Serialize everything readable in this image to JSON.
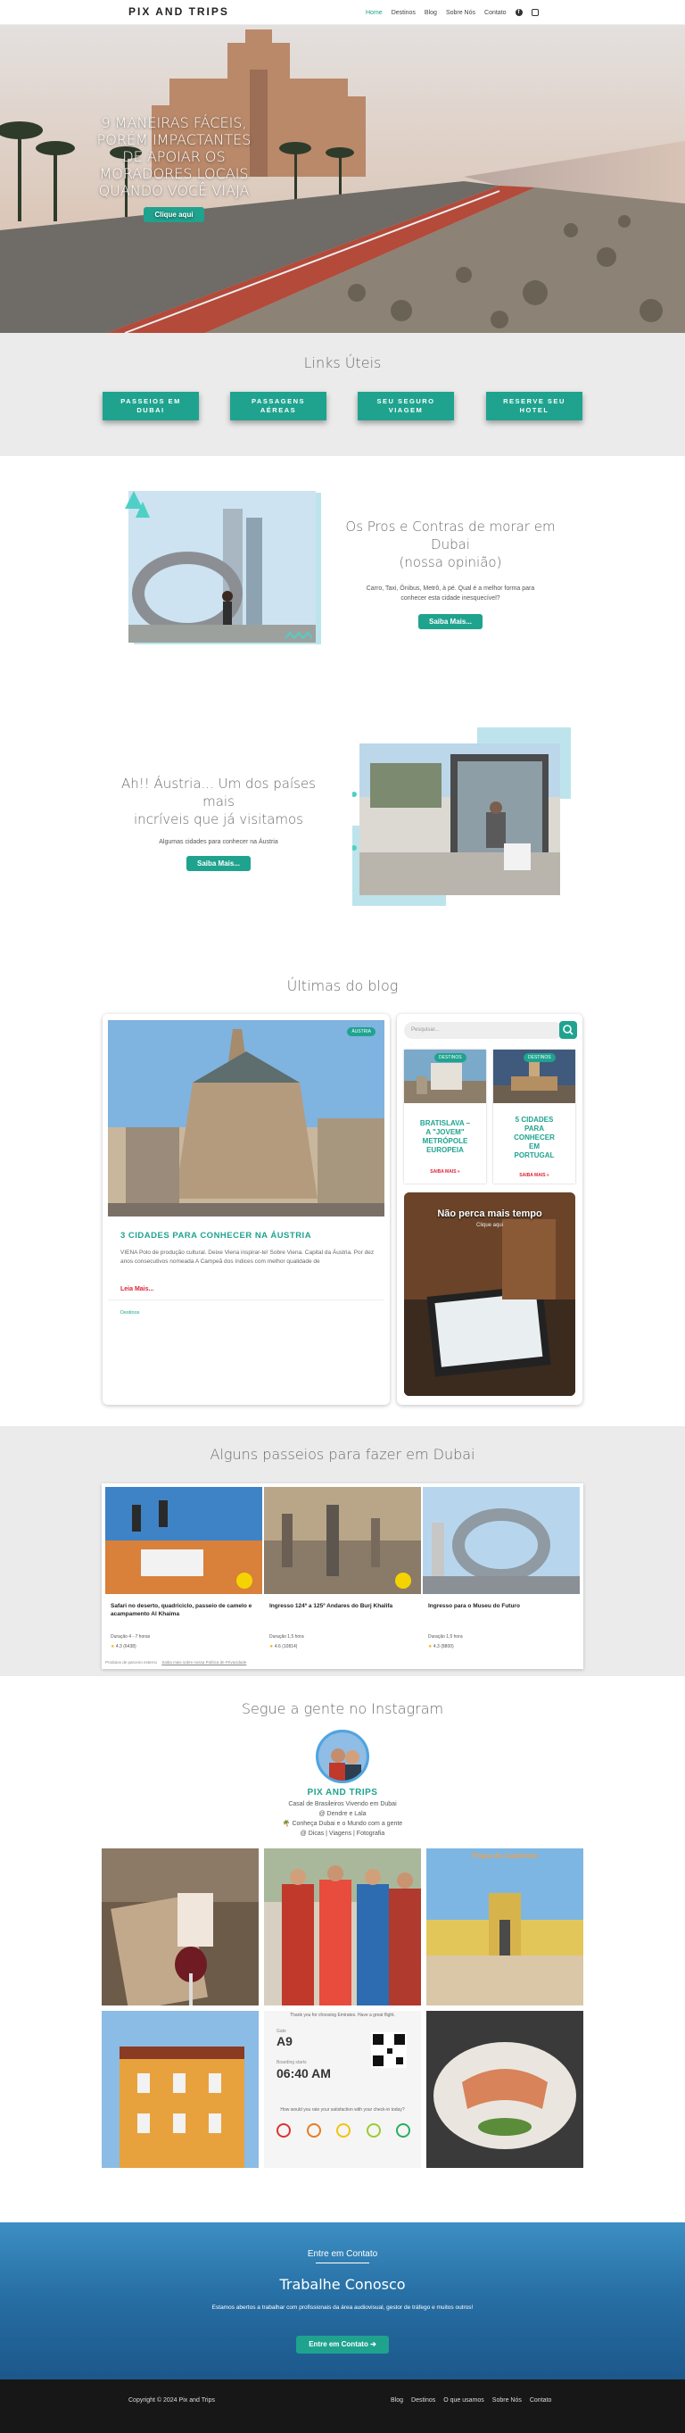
{
  "header": {
    "logo": "PIX AND TRIPS",
    "nav": [
      "Home",
      "Destinos",
      "Blog",
      "Sobre Nós",
      "Contato"
    ],
    "social_icons": [
      "facebook-icon",
      "instagram-icon"
    ]
  },
  "hero": {
    "caption": "9 MANEIRAS FÁCEIS, PORÉM IMPACTANTES DE APOIAR OS MORADORES LOCAIS QUANDO VOCÊ VIAJA",
    "button": "Clique aqui"
  },
  "links": {
    "title": "Links Úteis",
    "buttons": [
      "PASSEIOS EM DUBAI",
      "PASSAGENS AÉREAS",
      "SEGURO VIAGEM",
      "RESERVE SEU HOTEL"
    ],
    "button_lines": [
      [
        "PASSEIOS EM",
        "DUBAI"
      ],
      [
        "PASSAGENS",
        "AÉREAS"
      ],
      [
        "SEU SEGURO",
        "VIAGEM"
      ],
      [
        "RESERVE SEU",
        "HOTEL"
      ]
    ]
  },
  "pros": {
    "title_1": "Os Pros e Contras de morar em Dubai",
    "title_2": "(nossa opinião)",
    "text": "Carro, Taxi, Ônibus, Metrô, à pé. Qual é a melhor forma para conhecer esta cidade inesquecível?",
    "button": "Saiba Mais..."
  },
  "austria": {
    "title_1": "Ah!! Áustria... Um dos países mais",
    "title_2": "incríveis que já visitamos",
    "text": "Algumas cidades para conhecer na Áustria",
    "button": "Saiba Mais..."
  },
  "blog": {
    "title": "Últimas do blog",
    "featured": {
      "badge": "ÁUSTRIA",
      "title": "3 CIDADES PARA CONHECER NA ÁUSTRIA",
      "excerpt": "VIENA Polo de produção cultural. Deixe Viena inspirar-te! Sobre Viena. Capital da Áustria. Por dez anos consecutivos nomeada A Campeã dos índices com melhor qualidade de",
      "read_more": "Leia Mais...",
      "tag": "Destinos"
    },
    "search_placeholder": "Pesquisar...",
    "small_posts": [
      {
        "badge": "DESTINOS",
        "title": "BRATISLAVA – A \"JOVEM\" METRÓPOLE EUROPEIA",
        "title_lines": [
          "BRATISLAVA –",
          "A \"JOVEM\"",
          "METRÓPOLE",
          "EUROPEIA"
        ],
        "more": "SAIBA MAIS »"
      },
      {
        "badge": "DESTINOS",
        "title": "5 CIDADES PARA CONHECER EM PORTUGAL",
        "title_lines": [
          "5 CIDADES",
          "PARA",
          "CONHECER",
          "EM",
          "PORTUGAL"
        ],
        "more": "SAIBA MAIS »"
      }
    ],
    "promo": {
      "title": "Não perca mais tempo",
      "subtitle": "Clique aqui"
    }
  },
  "tours": {
    "title": "Alguns passeios para fazer em Dubai",
    "items": [
      {
        "title": "Safari no deserto, quadriciclo, passeio de camelo e acampamento Al Khaima",
        "duration": "Duração 4 - 7 horas",
        "rating": "4.3 (6438)"
      },
      {
        "title": "Ingresso 124º a 125º Andares do Burj Khalifa",
        "duration": "Duração 1,5 hora",
        "rating": "4.6 (10814)"
      },
      {
        "title": "Ingresso para o Museu do Futuro",
        "duration": "Duração 1,5 hora",
        "rating": "4.3 (8800)"
      }
    ],
    "footnote": "Produtos de parceiro externo",
    "footnote_link": "Saiba mais sobre nossa Política de Privacidade"
  },
  "instagram": {
    "title": "Segue a gente no Instagram",
    "name": "PIX AND TRIPS",
    "bio": [
      "Casal de Brasileiros Vivendo em Dubai",
      "@ Dendre e Lala",
      "🌴 Conheça Dubai e o Mundo com a gente",
      "@ Dicas | Viagens | Fotografia"
    ],
    "tiles": [
      {
        "caption": ""
      },
      {
        "caption": ""
      },
      {
        "caption": "Praça do Comércio"
      },
      {
        "caption": ""
      },
      {
        "caption": "06:40 AM"
      },
      {
        "caption": ""
      }
    ],
    "tile4": {
      "top": "Thank you for choosing Emirates. Have a great flight.",
      "gate_label": "Gate",
      "gate": "A9",
      "boarding_label": "Boarding starts",
      "boarding": "06:40 AM",
      "rate": "How would you rate your satisfaction with your check-in today?"
    }
  },
  "contact": {
    "label": "Entre em Contato",
    "title": "Trabalhe Conosco",
    "text": "Estamos abertos a trabalhar com profissionais da área audiovisual, gestor de tráfego e muitos outros!",
    "button": "Entre em Contato ➔"
  },
  "footer": {
    "copyright": "Copyright © 2024 Pix and Trips",
    "links": [
      "Blog",
      "Destinos",
      "O que usamos",
      "Sobre Nós",
      "Contato"
    ]
  },
  "colors": {
    "accent": "#1fa38f",
    "section_gray": "#ebebeb",
    "footer": "#171717"
  }
}
